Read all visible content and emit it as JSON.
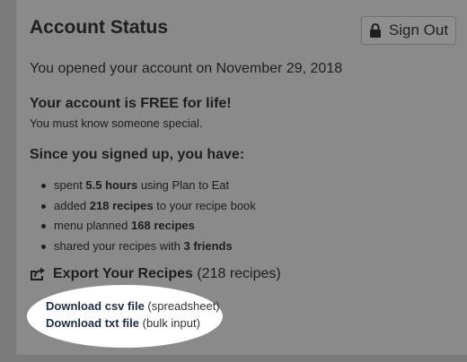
{
  "header": {
    "title": "Account Status",
    "sign_out_label": "Sign Out"
  },
  "account": {
    "opened_text": "You opened your account on November 29, 2018",
    "free_heading": "Your account is FREE for life!",
    "free_note": "You must know someone special."
  },
  "stats": {
    "heading": "Since you signed up, you have:",
    "items": [
      {
        "pre": "spent ",
        "bold": "5.5 hours",
        "post": " using Plan to Eat"
      },
      {
        "pre": "added ",
        "bold": "218 recipes",
        "post": " to your recipe book"
      },
      {
        "pre": "menu planned ",
        "bold": "168 recipes",
        "post": ""
      },
      {
        "pre": "shared your recipes with ",
        "bold": "3 friends",
        "post": ""
      }
    ]
  },
  "export": {
    "heading": "Export Your Recipes",
    "count": " (218 recipes)",
    "downloads": [
      {
        "label": "Download csv file",
        "note": " (spreadsheet)"
      },
      {
        "label": "Download txt file",
        "note": " (bulk input)"
      }
    ]
  },
  "icons": {
    "lock": "lock-icon",
    "export": "share-export-icon"
  }
}
